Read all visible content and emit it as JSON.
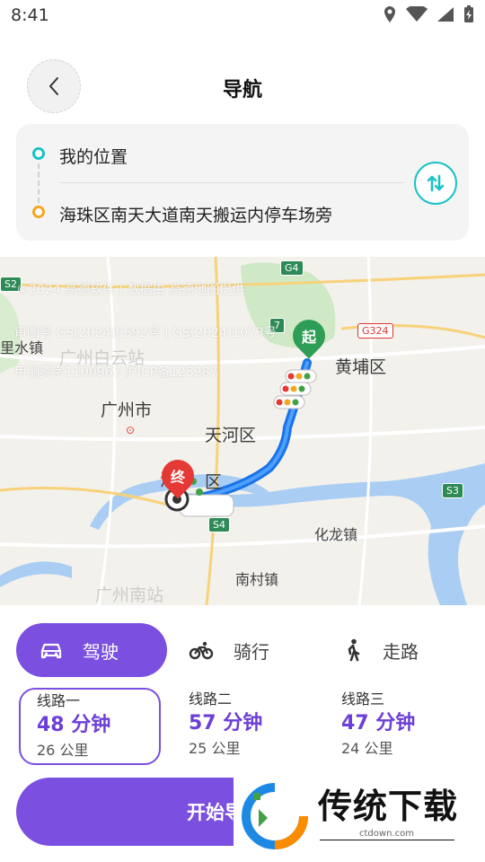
{
  "status": {
    "time": "8:41"
  },
  "header": {
    "title": "导航"
  },
  "route": {
    "start": "我的位置",
    "end": "海珠区南天大道南天搬运内停车场旁"
  },
  "map": {
    "labels": {
      "huangpu": "黄埔区",
      "guangzhou": "广州市",
      "tianhe": "天河区",
      "haizhu_partial": "海",
      "haizhu_end": "区",
      "hualong": "化龙镇",
      "nancun": "南村镇",
      "lishui": "里水镇",
      "baiyun_station": "广州白云站",
      "south_station": "广州南站"
    },
    "roads": {
      "g4": "G4",
      "g324": "G324",
      "s3": "S3",
      "s4": "S4",
      "s2": "S2",
      "r": "7"
    },
    "watermark": {
      "line1": "©2024 高德软件 | 数据由 高德地图提供",
      "line2": "审图号 GS(2024)5592号 | GS(2024)1073号",
      "line3": "甲测资字1100967 沪ICP备125287"
    },
    "markers": {
      "start": "起",
      "end": "终"
    }
  },
  "modes": [
    {
      "label": "驾驶",
      "icon": "car-icon",
      "active": true
    },
    {
      "label": "骑行",
      "icon": "bike-icon",
      "active": false
    },
    {
      "label": "走路",
      "icon": "walk-icon",
      "active": false
    }
  ],
  "routes": [
    {
      "name": "线路一",
      "time": "48 分钟",
      "distance": "26 公里"
    },
    {
      "name": "线路二",
      "time": "57 分钟",
      "distance": "25 公里"
    },
    {
      "name": "线路三",
      "time": "47 分钟",
      "distance": "24 公里"
    }
  ],
  "start_button": {
    "label": "开始导航"
  },
  "promo": {
    "title": "传统下载",
    "url": "ctdown.com"
  },
  "colors": {
    "accent": "#7b4fe0",
    "teal": "#19c2c9",
    "orange": "#f5a623",
    "route": "#1a73e8"
  }
}
